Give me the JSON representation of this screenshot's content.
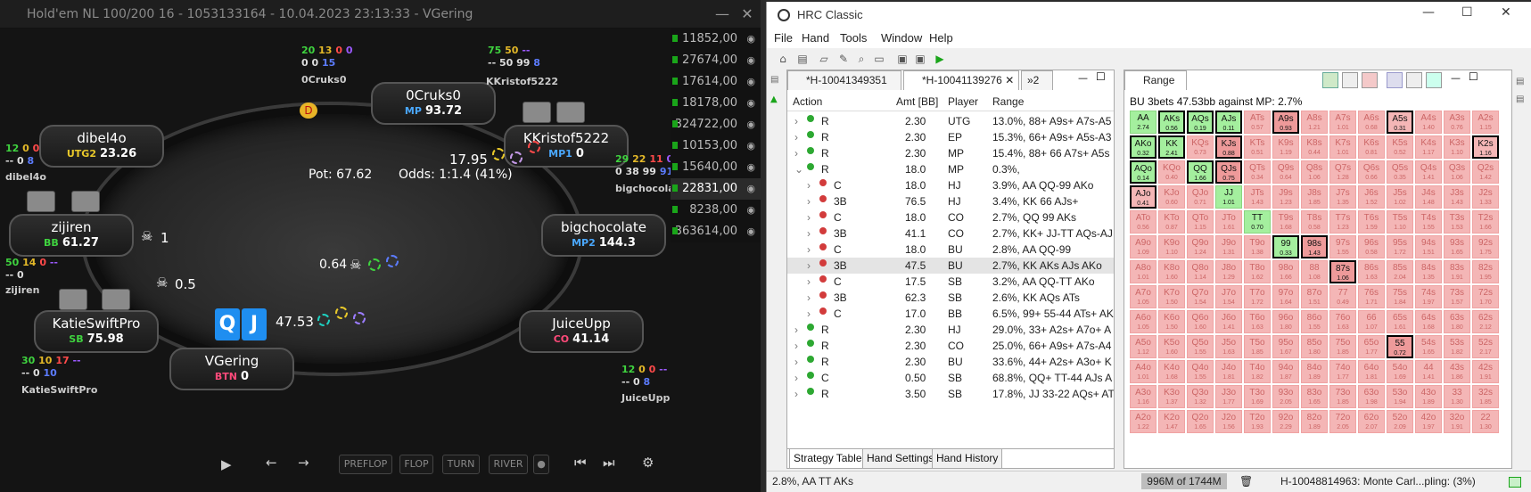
{
  "poker": {
    "title": "Hold'em NL 100/200 16 - 1053133164 - 10.04.2023 23:13:33 - VGering",
    "pot_label": "Pot:  67.62",
    "odds_label": "Odds:  1:1.4 (41%)",
    "hero_cards": [
      "Q",
      "J"
    ],
    "seats": [
      {
        "name": "0Cruks0",
        "pos": "MP",
        "stack": "93.72",
        "pos_color": "#4aa8ff"
      },
      {
        "name": "KKristof5222",
        "pos": "MP1",
        "stack": "0",
        "pos_color": "#4aa8ff"
      },
      {
        "name": "dibel4o",
        "pos": "UTG2",
        "stack": "23.26",
        "pos_color": "#e8c82a"
      },
      {
        "name": "bigchocolate",
        "pos": "MP2",
        "stack": "144.3",
        "pos_color": "#4aa8ff"
      },
      {
        "name": "zijiren",
        "pos": "BB",
        "stack": "61.27",
        "pos_color": "#3fd33f"
      },
      {
        "name": "JuiceUpp",
        "pos": "CO",
        "stack": "41.14",
        "pos_color": "#ff4a7a"
      },
      {
        "name": "KatieSwiftPro",
        "pos": "SB",
        "stack": "75.98",
        "pos_color": "#3fd33f"
      },
      {
        "name": "VGering",
        "pos": "BTN",
        "stack": "0",
        "pos_color": "#ff4a7a"
      }
    ],
    "huds": {
      "cruks": {
        "a": "20",
        "b": "13",
        "c": "0",
        "d": "0",
        "e": "0",
        "f": "15",
        "name": "0Cruks0"
      },
      "kk": {
        "a": "75",
        "b": "50",
        "c": "--",
        "d": "50",
        "e": "99",
        "f": "8",
        "name": "KKristof5222"
      },
      "dibel": {
        "a": "12",
        "b": "0",
        "c": "0",
        "d": "0",
        "e": "8",
        "name": "dibel4o"
      },
      "bigc": {
        "a": "29",
        "b": "22",
        "c": "11",
        "d": "0",
        "e": "0",
        "f": "38",
        "g": "99",
        "h": "91",
        "name": "bigchocolate"
      },
      "zij": {
        "a": "50",
        "b": "14",
        "c": "0",
        "d": "--",
        "name": "zijiren"
      },
      "juice": {
        "a": "12",
        "b": "0",
        "c": "0",
        "d": "--",
        "e": "0",
        "f": "8",
        "name": "JuiceUpp"
      },
      "katie": {
        "a": "30",
        "b": "10",
        "c": "17",
        "d": "--",
        "e": "0",
        "f": "10",
        "name": "KatieSwiftPro"
      }
    },
    "bets": {
      "kk": "17.95",
      "hero": "47.53",
      "mid": "0.64",
      "zij": "1",
      "katie": "0.5"
    },
    "board_buttons": [
      "PREFLOP",
      "FLOP",
      "TURN",
      "RIVER"
    ],
    "tables": [
      "11852,00",
      "27674,00",
      "17614,00",
      "18178,00",
      "324722,00",
      "10153,00",
      "15640,00",
      "22831,00",
      "8238,00",
      "363614,00"
    ]
  },
  "hrc": {
    "title": "HRC Classic",
    "menu": [
      "File",
      "Hand",
      "Tools",
      "Window",
      "Help"
    ],
    "tabs": [
      "*H-10041349351",
      "*H-10041139276",
      "»2"
    ],
    "columns": [
      "Action",
      "Amt [BB]",
      "Player",
      "Range"
    ],
    "rows": [
      {
        "a": "R",
        "amt": "2.30",
        "p": "UTG",
        "r": "13.0%, 88+ A9s+ A7s-A5",
        "c": "g",
        "lvl": 0
      },
      {
        "a": "R",
        "amt": "2.30",
        "p": "EP",
        "r": "15.3%, 66+ A9s+ A5s-A3",
        "c": "g",
        "lvl": 0
      },
      {
        "a": "R",
        "amt": "2.30",
        "p": "MP",
        "r": "15.4%, 88+ 66 A7s+ A5s",
        "c": "g",
        "lvl": 0
      },
      {
        "a": "R",
        "amt": "18.0",
        "p": "MP",
        "r": "0.3%,",
        "c": "g",
        "lvl": 0,
        "open": true
      },
      {
        "a": "C",
        "amt": "18.0",
        "p": "HJ",
        "r": "3.9%, AA QQ-99 AKo",
        "c": "r",
        "lvl": 1
      },
      {
        "a": "3B",
        "amt": "76.5",
        "p": "HJ",
        "r": "3.4%, KK 66 AJs+",
        "c": "r",
        "lvl": 1
      },
      {
        "a": "C",
        "amt": "18.0",
        "p": "CO",
        "r": "2.7%, QQ 99 AKs",
        "c": "r",
        "lvl": 1
      },
      {
        "a": "3B",
        "amt": "41.1",
        "p": "CO",
        "r": "2.7%, KK+ JJ-TT AQs-AJ",
        "c": "r",
        "lvl": 1
      },
      {
        "a": "C",
        "amt": "18.0",
        "p": "BU",
        "r": "2.8%, AA QQ-99",
        "c": "r",
        "lvl": 1
      },
      {
        "a": "3B",
        "amt": "47.5",
        "p": "BU",
        "r": "2.7%, KK AKs AJs AKo",
        "c": "r",
        "lvl": 1,
        "sel": true
      },
      {
        "a": "C",
        "amt": "17.5",
        "p": "SB",
        "r": "3.2%, AA QQ-TT AKo",
        "c": "r",
        "lvl": 1
      },
      {
        "a": "3B",
        "amt": "62.3",
        "p": "SB",
        "r": "2.6%, KK AQs ATs",
        "c": "r",
        "lvl": 1
      },
      {
        "a": "C",
        "amt": "17.0",
        "p": "BB",
        "r": "6.5%, 99+ 55-44 ATs+ AK",
        "c": "r",
        "lvl": 1
      },
      {
        "a": "R",
        "amt": "2.30",
        "p": "HJ",
        "r": "29.0%, 33+ A2s+ A7o+ A",
        "c": "g",
        "lvl": 0
      },
      {
        "a": "R",
        "amt": "2.30",
        "p": "CO",
        "r": "25.0%, 66+ A9s+ A7s-A4",
        "c": "g",
        "lvl": 0
      },
      {
        "a": "R",
        "amt": "2.30",
        "p": "BU",
        "r": "33.6%, 44+ A2s+ A3o+ K",
        "c": "g",
        "lvl": 0
      },
      {
        "a": "C",
        "amt": "0.50",
        "p": "SB",
        "r": "68.8%, QQ+ TT-44 AJs A",
        "c": "g",
        "lvl": 0
      },
      {
        "a": "R",
        "amt": "3.50",
        "p": "SB",
        "r": "17.8%, JJ 33-22 AQs+ AT",
        "c": "g",
        "lvl": 0
      }
    ],
    "bottom_tabs": [
      "Strategy Table",
      "Hand Settings",
      "Hand History"
    ],
    "range_tab": "Range",
    "range_title": "BU 3bets 47.53bb against MP: 2.7%",
    "grid": [
      [
        [
          "AA",
          "2.74",
          "g"
        ],
        [
          "AKs",
          "0.56",
          "gs"
        ],
        [
          "AQs",
          "0.19",
          "gs"
        ],
        [
          "AJs",
          "0.11",
          "gs"
        ],
        [
          "ATs",
          "0.57",
          ""
        ],
        [
          "A9s",
          "0.93",
          "ds"
        ],
        [
          "A8s",
          "1.21",
          ""
        ],
        [
          "A7s",
          "1.01",
          ""
        ],
        [
          "A6s",
          "0.68",
          ""
        ],
        [
          "A5s",
          "0.31",
          "s"
        ],
        [
          "A4s",
          "1.40",
          ""
        ],
        [
          "A3s",
          "0.76",
          ""
        ],
        [
          "A2s",
          "1.15",
          ""
        ]
      ],
      [
        [
          "AKo",
          "0.32",
          "gs"
        ],
        [
          "KK",
          "2.41",
          "gs"
        ],
        [
          "KQs",
          "0.73",
          ""
        ],
        [
          "KJs",
          "0.88",
          "ds"
        ],
        [
          "KTs",
          "0.51",
          ""
        ],
        [
          "K9s",
          "1.19",
          ""
        ],
        [
          "K8s",
          "0.44",
          ""
        ],
        [
          "K7s",
          "1.01",
          ""
        ],
        [
          "K6s",
          "0.81",
          ""
        ],
        [
          "K5s",
          "0.52",
          ""
        ],
        [
          "K4s",
          "1.17",
          ""
        ],
        [
          "K3s",
          "1.10",
          ""
        ],
        [
          "K2s",
          "1.16",
          "s"
        ]
      ],
      [
        [
          "AQo",
          "0.14",
          "gs"
        ],
        [
          "KQo",
          "0.40",
          ""
        ],
        [
          "QQ",
          "1.66",
          "gs"
        ],
        [
          "QJs",
          "0.75",
          "ds"
        ],
        [
          "QTs",
          "0.34",
          ""
        ],
        [
          "Q9s",
          "0.64",
          ""
        ],
        [
          "Q8s",
          "1.06",
          ""
        ],
        [
          "Q7s",
          "1.28",
          ""
        ],
        [
          "Q6s",
          "0.66",
          ""
        ],
        [
          "Q5s",
          "0.35",
          ""
        ],
        [
          "Q4s",
          "1.41",
          ""
        ],
        [
          "Q3s",
          "1.06",
          ""
        ],
        [
          "Q2s",
          "1.42",
          ""
        ]
      ],
      [
        [
          "AJo",
          "0.41",
          "s"
        ],
        [
          "KJo",
          "0.60",
          ""
        ],
        [
          "QJo",
          "0.71",
          ""
        ],
        [
          "JJ",
          "1.01",
          "g"
        ],
        [
          "JTs",
          "1.43",
          ""
        ],
        [
          "J9s",
          "1.23",
          ""
        ],
        [
          "J8s",
          "1.85",
          ""
        ],
        [
          "J7s",
          "1.35",
          ""
        ],
        [
          "J6s",
          "1.52",
          ""
        ],
        [
          "J5s",
          "1.02",
          ""
        ],
        [
          "J4s",
          "1.48",
          ""
        ],
        [
          "J3s",
          "1.43",
          ""
        ],
        [
          "J2s",
          "1.33",
          ""
        ]
      ],
      [
        [
          "ATo",
          "0.56",
          ""
        ],
        [
          "KTo",
          "0.87",
          ""
        ],
        [
          "QTo",
          "1.15",
          ""
        ],
        [
          "JTo",
          "1.61",
          ""
        ],
        [
          "TT",
          "0.70",
          "g"
        ],
        [
          "T9s",
          "1.68",
          ""
        ],
        [
          "T8s",
          "0.58",
          ""
        ],
        [
          "T7s",
          "1.23",
          ""
        ],
        [
          "T6s",
          "1.59",
          ""
        ],
        [
          "T5s",
          "1.10",
          ""
        ],
        [
          "T4s",
          "1.55",
          ""
        ],
        [
          "T3s",
          "1.53",
          ""
        ],
        [
          "T2s",
          "1.66",
          ""
        ]
      ],
      [
        [
          "A9o",
          "1.09",
          ""
        ],
        [
          "K9o",
          "1.10",
          ""
        ],
        [
          "Q9o",
          "1.24",
          ""
        ],
        [
          "J9o",
          "1.31",
          ""
        ],
        [
          "T9o",
          "1.38",
          ""
        ],
        [
          "99",
          "0.33",
          "gs"
        ],
        [
          "98s",
          "1.43",
          "ds"
        ],
        [
          "97s",
          "1.55",
          ""
        ],
        [
          "96s",
          "0.58",
          ""
        ],
        [
          "95s",
          "1.72",
          ""
        ],
        [
          "94s",
          "1.51",
          ""
        ],
        [
          "93s",
          "1.65",
          ""
        ],
        [
          "92s",
          "1.75",
          ""
        ]
      ],
      [
        [
          "A8o",
          "1.01",
          ""
        ],
        [
          "K8o",
          "1.60",
          ""
        ],
        [
          "Q8o",
          "1.14",
          ""
        ],
        [
          "J8o",
          "1.29",
          ""
        ],
        [
          "T8o",
          "1.62",
          ""
        ],
        [
          "98o",
          "1.66",
          ""
        ],
        [
          "88",
          "1.08",
          ""
        ],
        [
          "87s",
          "1.06",
          "ds"
        ],
        [
          "86s",
          "1.63",
          ""
        ],
        [
          "85s",
          "2.04",
          ""
        ],
        [
          "84s",
          "1.35",
          ""
        ],
        [
          "83s",
          "1.91",
          ""
        ],
        [
          "82s",
          "1.95",
          ""
        ]
      ],
      [
        [
          "A7o",
          "1.05",
          ""
        ],
        [
          "K7o",
          "1.50",
          ""
        ],
        [
          "Q7o",
          "1.54",
          ""
        ],
        [
          "J7o",
          "1.54",
          ""
        ],
        [
          "T7o",
          "1.72",
          ""
        ],
        [
          "97o",
          "1.64",
          ""
        ],
        [
          "87o",
          "1.51",
          ""
        ],
        [
          "77",
          "0.49",
          ""
        ],
        [
          "76s",
          "1.71",
          ""
        ],
        [
          "75s",
          "1.84",
          ""
        ],
        [
          "74s",
          "1.97",
          ""
        ],
        [
          "73s",
          "1.57",
          ""
        ],
        [
          "72s",
          "1.70",
          ""
        ]
      ],
      [
        [
          "A6o",
          "1.05",
          ""
        ],
        [
          "K6o",
          "1.50",
          ""
        ],
        [
          "Q6o",
          "1.60",
          ""
        ],
        [
          "J6o",
          "1.41",
          ""
        ],
        [
          "T6o",
          "1.63",
          ""
        ],
        [
          "96o",
          "1.80",
          ""
        ],
        [
          "86o",
          "1.55",
          ""
        ],
        [
          "76o",
          "1.63",
          ""
        ],
        [
          "66",
          "1.07",
          ""
        ],
        [
          "65s",
          "1.61",
          ""
        ],
        [
          "64s",
          "1.68",
          ""
        ],
        [
          "63s",
          "1.80",
          ""
        ],
        [
          "62s",
          "2.12",
          ""
        ]
      ],
      [
        [
          "A5o",
          "1.12",
          ""
        ],
        [
          "K5o",
          "1.60",
          ""
        ],
        [
          "Q5o",
          "1.55",
          ""
        ],
        [
          "J5o",
          "1.63",
          ""
        ],
        [
          "T5o",
          "1.85",
          ""
        ],
        [
          "95o",
          "1.67",
          ""
        ],
        [
          "85o",
          "1.80",
          ""
        ],
        [
          "75o",
          "1.85",
          ""
        ],
        [
          "65o",
          "1.77",
          ""
        ],
        [
          "55",
          "0.72",
          "ds"
        ],
        [
          "54s",
          "1.65",
          ""
        ],
        [
          "53s",
          "1.82",
          ""
        ],
        [
          "52s",
          "2.17",
          ""
        ]
      ],
      [
        [
          "A4o",
          "1.01",
          ""
        ],
        [
          "K4o",
          "1.68",
          ""
        ],
        [
          "Q4o",
          "1.55",
          ""
        ],
        [
          "J4o",
          "1.81",
          ""
        ],
        [
          "T4o",
          "1.82",
          ""
        ],
        [
          "94o",
          "1.87",
          ""
        ],
        [
          "84o",
          "1.89",
          ""
        ],
        [
          "74o",
          "1.77",
          ""
        ],
        [
          "64o",
          "1.81",
          ""
        ],
        [
          "54o",
          "1.69",
          ""
        ],
        [
          "44",
          "1.41",
          ""
        ],
        [
          "43s",
          "1.86",
          ""
        ],
        [
          "42s",
          "1.91",
          ""
        ]
      ],
      [
        [
          "A3o",
          "1.16",
          ""
        ],
        [
          "K3o",
          "1.37",
          ""
        ],
        [
          "Q3o",
          "1.32",
          ""
        ],
        [
          "J3o",
          "1.77",
          ""
        ],
        [
          "T3o",
          "1.69",
          ""
        ],
        [
          "93o",
          "2.05",
          ""
        ],
        [
          "83o",
          "1.65",
          ""
        ],
        [
          "73o",
          "1.85",
          ""
        ],
        [
          "63o",
          "1.98",
          ""
        ],
        [
          "53o",
          "1.94",
          ""
        ],
        [
          "43o",
          "1.89",
          ""
        ],
        [
          "33",
          "1.30",
          ""
        ],
        [
          "32s",
          "1.85",
          ""
        ]
      ],
      [
        [
          "A2o",
          "1.22",
          ""
        ],
        [
          "K2o",
          "1.47",
          ""
        ],
        [
          "Q2o",
          "1.65",
          ""
        ],
        [
          "J2o",
          "1.56",
          ""
        ],
        [
          "T2o",
          "1.93",
          ""
        ],
        [
          "92o",
          "2.29",
          ""
        ],
        [
          "82o",
          "1.89",
          ""
        ],
        [
          "72o",
          "2.05",
          ""
        ],
        [
          "62o",
          "2.07",
          ""
        ],
        [
          "52o",
          "2.09",
          ""
        ],
        [
          "42o",
          "1.97",
          ""
        ],
        [
          "32o",
          "1.91",
          ""
        ],
        [
          "22",
          "1.30",
          ""
        ]
      ]
    ],
    "status_left": "2.8%, AA TT AKs",
    "status_mem": "996M of 1744M",
    "status_job": "H-10048814963: Monte Carl...pling: (3%)"
  }
}
